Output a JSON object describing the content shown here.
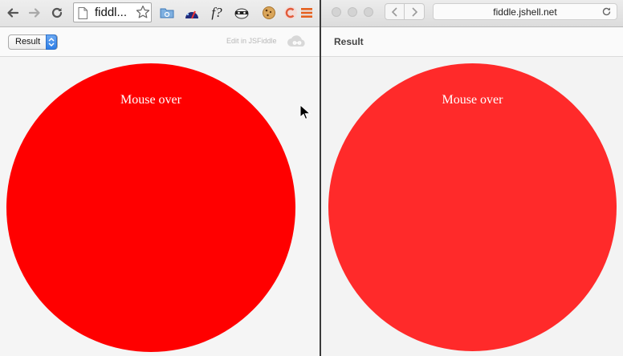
{
  "chrome": {
    "tab_url_text": "fiddl...",
    "result_select_value": "Result",
    "edit_link": "Edit in JSFiddle",
    "ext_fx_label": "f?"
  },
  "safari": {
    "address": "fiddle.jshell.net",
    "result_label": "Result"
  },
  "demo": {
    "left_circle_text": "Mouse over",
    "right_circle_text": "Mouse over",
    "left_circle_color": "#ff0000",
    "right_circle_color": "#ff2a2a"
  },
  "icons": {
    "chrome_toolbar": [
      "back-arrow-icon",
      "forward-arrow-icon",
      "reload-icon",
      "page-icon",
      "star-icon",
      "folder-icon",
      "gauge-icon",
      "fx-icon",
      "mask-icon",
      "cookie-icon",
      "extension-c-icon",
      "menu-icon"
    ],
    "jsfiddle": [
      "cloud-icon"
    ],
    "safari_toolbar": [
      "traffic-light-close",
      "traffic-light-minimize",
      "traffic-light-zoom",
      "chevron-left-icon",
      "chevron-right-icon",
      "reload-icon"
    ]
  }
}
